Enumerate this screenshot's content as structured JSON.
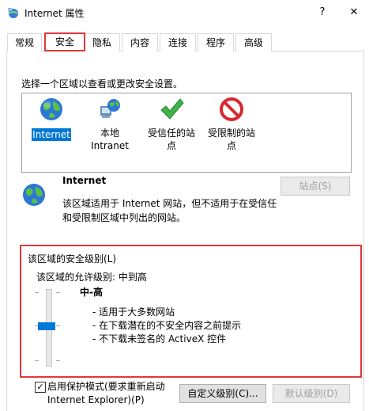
{
  "window": {
    "title": "Internet 属性",
    "help_label": "?",
    "close_label": "✕"
  },
  "tabs": [
    {
      "label": "常规"
    },
    {
      "label": "安全",
      "active": true
    },
    {
      "label": "隐私"
    },
    {
      "label": "内容"
    },
    {
      "label": "连接"
    },
    {
      "label": "程序"
    },
    {
      "label": "高级"
    }
  ],
  "security": {
    "prompt": "选择一个区域以查看或更改安全设置。",
    "zones": [
      {
        "label": "Internet",
        "icon": "globe-icon",
        "selected": true
      },
      {
        "label": "本地\nIntranet",
        "icon": "intranet-globe-icon"
      },
      {
        "label": "受信任的站\n点",
        "icon": "green-check-icon"
      },
      {
        "label": "受限制的站\n点",
        "icon": "red-no-icon"
      }
    ],
    "zone_info": {
      "title": "Internet",
      "description": "该区域适用于 Internet 网站，但不适用于在受信任和受限制区域中列出的网站。",
      "sites_button": "站点(S)"
    },
    "level_group": {
      "title": "该区域的安全级别(L)",
      "allowed": "该区域的允许级别: 中到高",
      "level_name": "中-高",
      "descriptions": [
        "- 适用于大多数网站",
        "- 在下载潜在的不安全内容之前提示",
        "- 不下载未签名的 ActiveX 控件"
      ],
      "slider_value": "3 of 5"
    },
    "protected_mode": {
      "label_line1": "启用保护模式(要求重新启动",
      "label_line2": "Internet Explorer)(P)",
      "checked": true
    },
    "custom_level_button": "自定义级别(C)...",
    "default_level_button": "默认级别(D)"
  },
  "colors": {
    "accent": "#0078d7",
    "highlight_red": "#e0383a"
  }
}
